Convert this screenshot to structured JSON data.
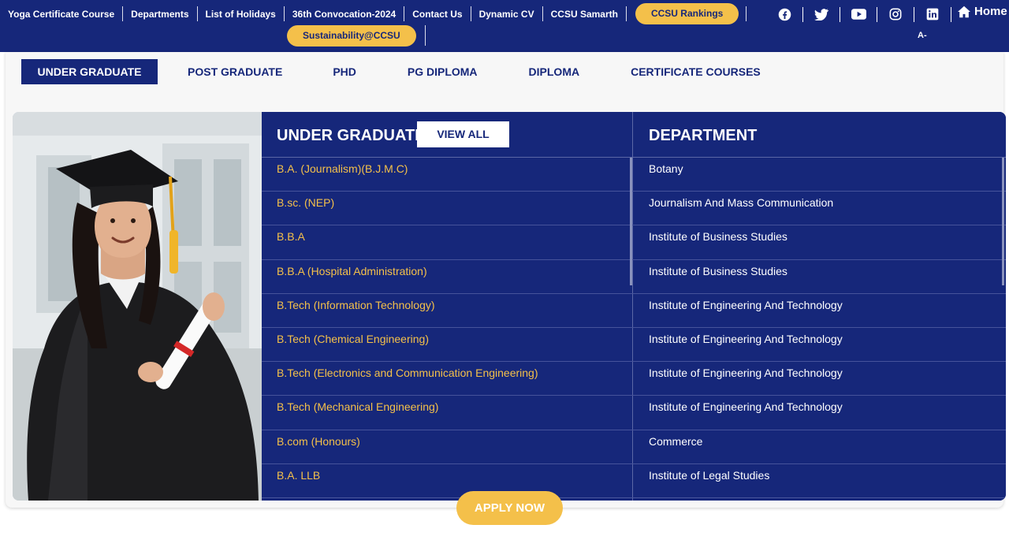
{
  "topnav": {
    "links": [
      "Yoga Certificate Course",
      "Departments",
      "List of Holidays",
      "36th Convocation-2024",
      "Contact Us",
      "Dynamic CV",
      "CCSU Samarth"
    ],
    "rankings_button": "CCSU Rankings",
    "sustainability_button": "Sustainability@CCSU",
    "home_label": "Home",
    "font_size_decrease": "A-"
  },
  "social_icons": [
    "facebook-icon",
    "twitter-icon",
    "youtube-icon",
    "instagram-icon",
    "linkedin-icon"
  ],
  "tabs": [
    {
      "label": "UNDER GRADUATE",
      "active": true
    },
    {
      "label": "POST GRADUATE",
      "active": false
    },
    {
      "label": "PHD",
      "active": false
    },
    {
      "label": "PG DIPLOMA",
      "active": false
    },
    {
      "label": "DIPLOMA",
      "active": false
    },
    {
      "label": "CERTIFICATE COURSES",
      "active": false
    }
  ],
  "programs": {
    "heading": "UNDER GRADUATE",
    "view_all": "VIEW ALL",
    "department_heading": "DEPARTMENT",
    "rows": [
      {
        "course": "B.A. (Journalism)(B.J.M.C)",
        "department": "Botany"
      },
      {
        "course": "B.sc. (NEP)",
        "department": "Journalism And Mass Communication"
      },
      {
        "course": "B.B.A",
        "department": "Institute of Business Studies"
      },
      {
        "course": "B.B.A (Hospital Administration)",
        "department": "Institute of Business Studies"
      },
      {
        "course": "B.Tech (Information Technology)",
        "department": "Institute of Engineering And Technology"
      },
      {
        "course": "B.Tech (Chemical Engineering)",
        "department": "Institute of Engineering And Technology"
      },
      {
        "course": "B.Tech (Electronics and Communication Engineering)",
        "department": "Institute of Engineering And Technology"
      },
      {
        "course": "B.Tech (Mechanical Engineering)",
        "department": "Institute of Engineering And Technology"
      },
      {
        "course": "B.com (Honours)",
        "department": "Commerce"
      },
      {
        "course": "B.A. LLB",
        "department": "Institute of Legal Studies"
      }
    ]
  },
  "apply_button": "APPLY NOW",
  "colors": {
    "navy": "#16277a",
    "gold": "#f4c04a",
    "white": "#ffffff"
  }
}
